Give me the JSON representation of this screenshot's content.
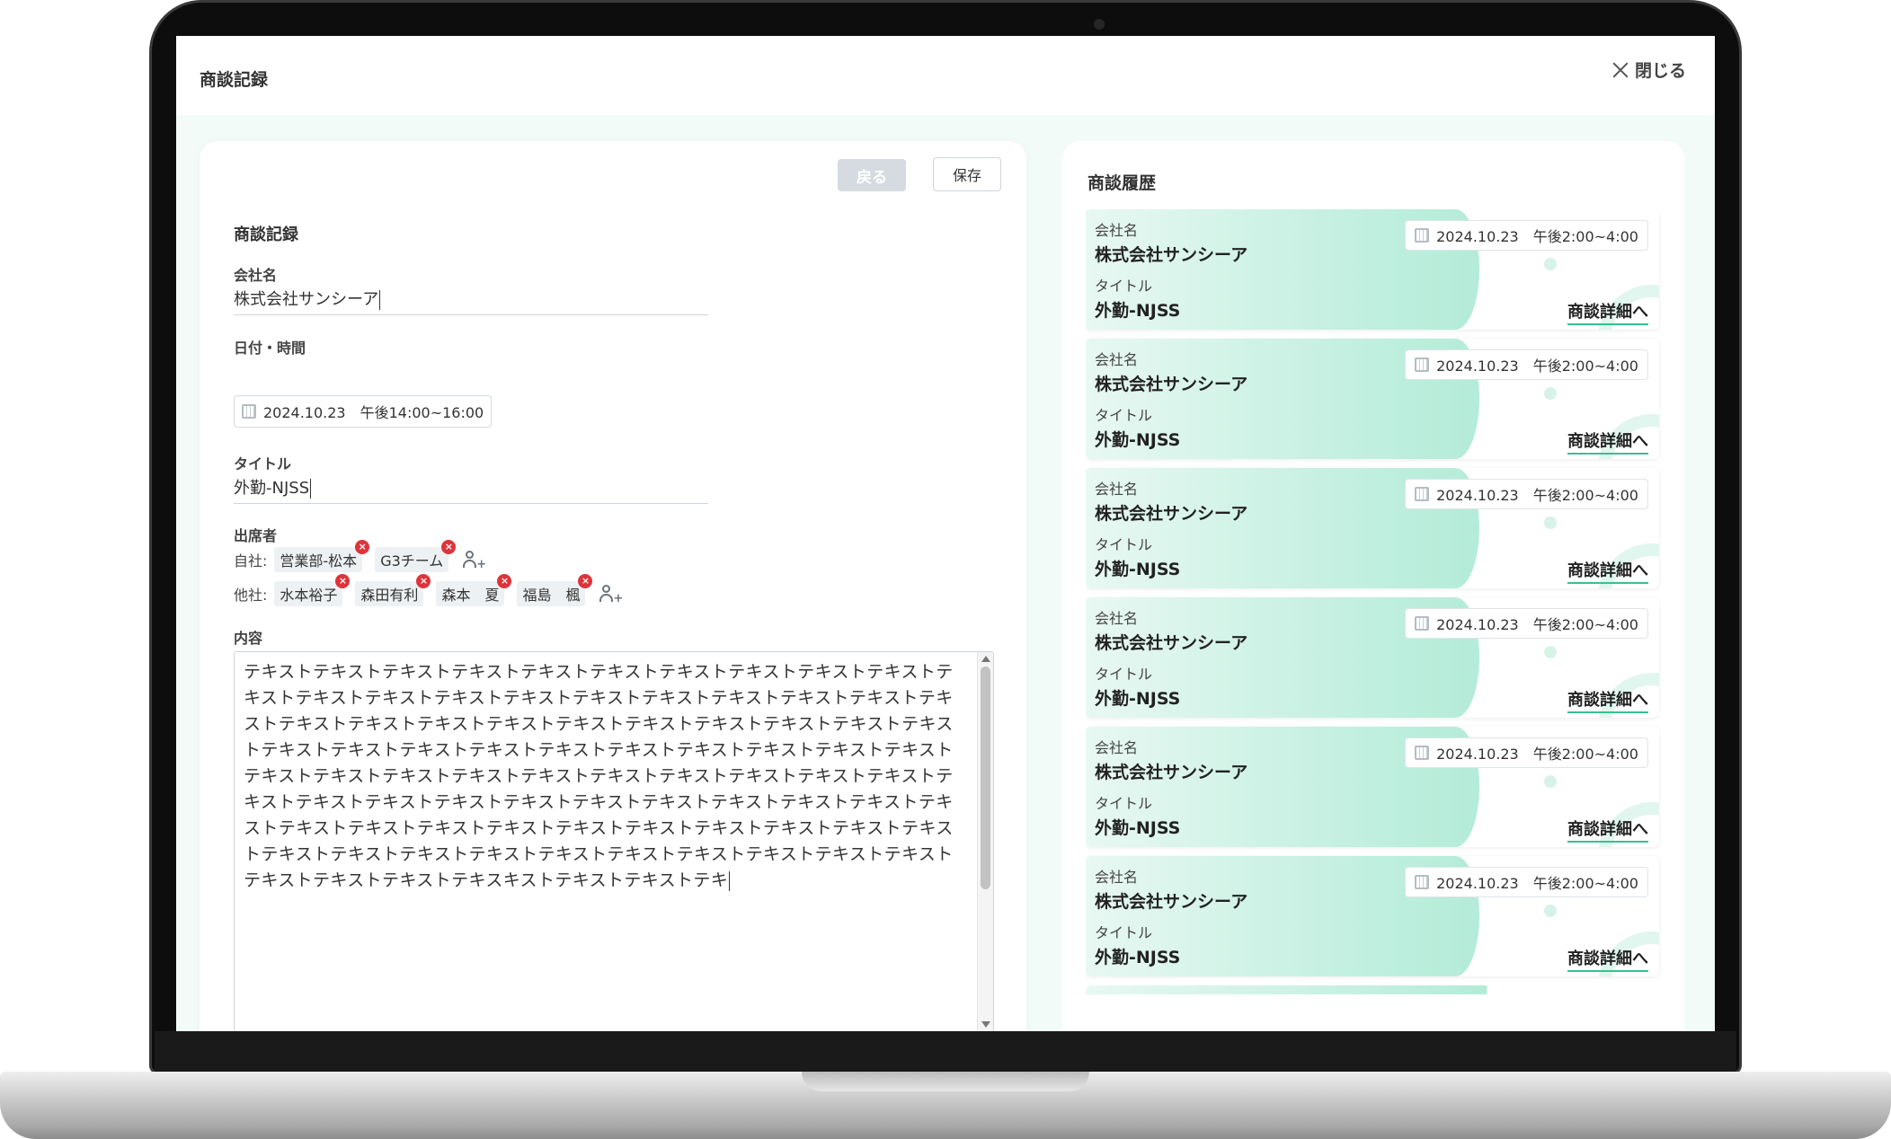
{
  "app": {
    "title": "商談記録",
    "close_label": "閉じる"
  },
  "form": {
    "back_label": "戻る",
    "save_label": "保存",
    "section_title": "商談記録",
    "company_label": "会社名",
    "company_value": "株式会社サンシーア",
    "datetime_label": "日付・時間",
    "datetime_value": "2024.10.23　午後14:00~16:00",
    "title_label": "タイトル",
    "title_value": "外勤-NJSS",
    "attendees_label": "出席者",
    "own_company_label": "自社:",
    "own_attendees": [
      "営業部-松本",
      "G3チーム"
    ],
    "other_company_label": "他社:",
    "other_attendees": [
      "水本裕子",
      "森田有利",
      "森本　夏",
      "福島　楓"
    ],
    "content_label": "内容",
    "content_value": "テキストテキストテキストテキストテキストテキストテキストテキストテキストテキストテキストテキストテキストテキストテキストテキストテキストテキストテキストテキストテキストテキストテキストテキストテキストテキストテキストテキストテキストテキストテキストテキストテキストテキストテキストテキストテキストテキストテキストテキストテキストテキストテキストテキストテキストテキストテキストテキストテキストテキストテキストテキストテキストテキストテキストテキストテキストテキストテキストテキストテキストテキストテキストテキストテキストテキストテキストテキストテキストテキストテキストテキストテキストテキストテキストテキストテキストテキストテキストテキストテキストテキストテキストテキストテキストテキスキストテキストテキストテキ"
  },
  "history": {
    "title": "商談履歴",
    "items": [
      {
        "company_label": "会社名",
        "company": "株式会社サンシーア",
        "title_label": "タイトル",
        "title": "外勤-NJSS",
        "date": "2024.10.23　午後2:00~4:00",
        "link": "商談詳細へ"
      },
      {
        "company_label": "会社名",
        "company": "株式会社サンシーア",
        "title_label": "タイトル",
        "title": "外勤-NJSS",
        "date": "2024.10.23　午後2:00~4:00",
        "link": "商談詳細へ"
      },
      {
        "company_label": "会社名",
        "company": "株式会社サンシーア",
        "title_label": "タイトル",
        "title": "外勤-NJSS",
        "date": "2024.10.23　午後2:00~4:00",
        "link": "商談詳細へ"
      },
      {
        "company_label": "会社名",
        "company": "株式会社サンシーア",
        "title_label": "タイトル",
        "title": "外勤-NJSS",
        "date": "2024.10.23　午後2:00~4:00",
        "link": "商談詳細へ"
      },
      {
        "company_label": "会社名",
        "company": "株式会社サンシーア",
        "title_label": "タイトル",
        "title": "外勤-NJSS",
        "date": "2024.10.23　午後2:00~4:00",
        "link": "商談詳細へ"
      },
      {
        "company_label": "会社名",
        "company": "株式会社サンシーア",
        "title_label": "タイトル",
        "title": "外勤-NJSS",
        "date": "2024.10.23　午後2:00~4:00",
        "link": "商談詳細へ"
      }
    ]
  },
  "colors": {
    "accent": "#39c08f",
    "card_gradient": "#b3ecd8",
    "remove_badge": "#e0323a",
    "disabled_button": "#d5dbe0"
  },
  "icons": [
    "close-icon",
    "calendar-icon",
    "remove-icon",
    "add-user-icon"
  ]
}
